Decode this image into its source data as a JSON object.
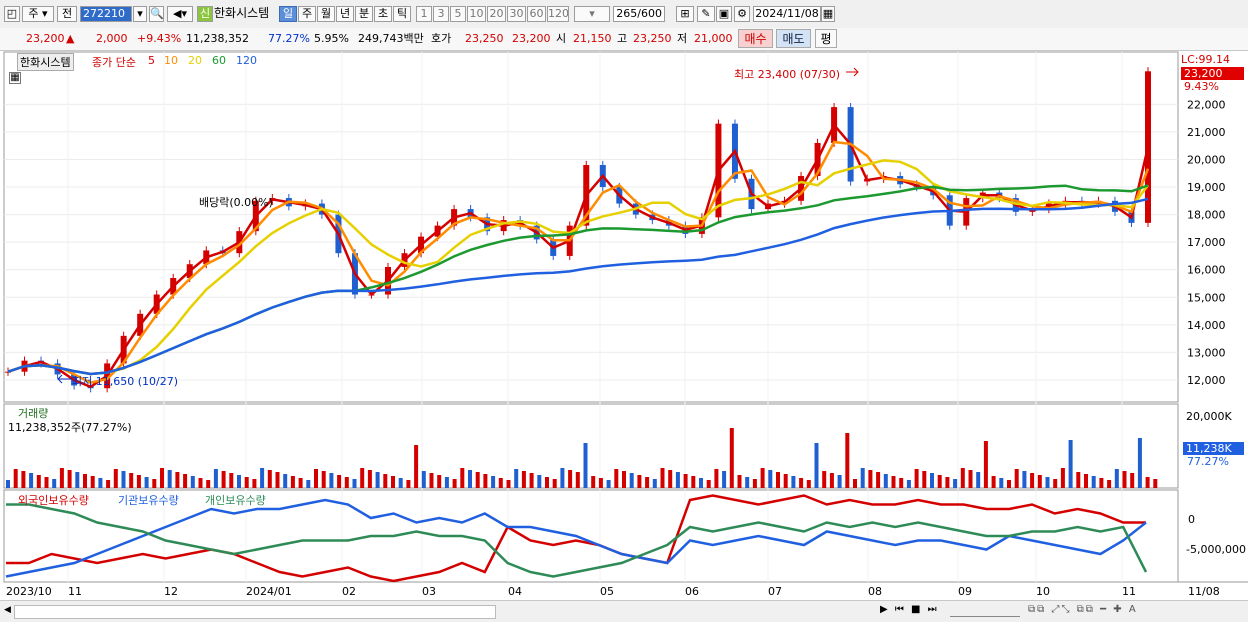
{
  "toolbar": {
    "market_label": "주",
    "prev_label": "전",
    "stock_code": "272210",
    "stock_name": "한화시스템",
    "new_label": "신",
    "period_buttons": [
      "일",
      "주",
      "월",
      "년",
      "분",
      "초",
      "틱"
    ],
    "active_period": "일",
    "interval_buttons": [
      "1",
      "3",
      "5",
      "10",
      "20",
      "30",
      "60",
      "120"
    ],
    "count_value": "265",
    "count_max": "/600",
    "date_value": "2024/11/08"
  },
  "quote": {
    "price": "23,200",
    "arrow": "▲",
    "change": "2,000",
    "change_rate": "+9.43%",
    "volume": "11,238,352",
    "vol_ratio": "77.27%",
    "turnover": "5.95%",
    "amount": "249,743백만",
    "hoga_label": "호가",
    "ask": "23,250",
    "bid": "23,200",
    "open_label": "시",
    "open": "21,150",
    "high_label": "고",
    "high": "23,250",
    "low_label": "저",
    "low": "21,000",
    "buy_label": "매수",
    "sell_label": "매도",
    "eval_label": "평"
  },
  "price_panel": {
    "name_tag": "한화시스템",
    "legend_prefix": "종가 단순",
    "ma_periods": [
      "5",
      "10",
      "20",
      "60",
      "120"
    ],
    "ma_colors": [
      "#d40000",
      "#ff8c00",
      "#e6d000",
      "#1c9a30",
      "#2060e0"
    ],
    "lc_label": "LC:99.14",
    "last_price_box": "23,200",
    "last_rate": "9.43%",
    "annot_high": "최고 23,400 (07/30)",
    "annot_low": "최저 11,650 (10/27)",
    "annot_div": "배당락(0.00%)"
  },
  "volume_panel": {
    "title": "거래량",
    "subtitle": "11,238,352주(77.27%)",
    "last_box": "11,238K",
    "last_rate": "77.27%",
    "tick_top": "20,000K"
  },
  "holding_panel": {
    "legend": [
      "외국인보유수량",
      "기관보유수량",
      "개인보유수량"
    ],
    "colors": [
      "#d40000",
      "#2060e0",
      "#2e8b57"
    ],
    "ticks": [
      "0",
      "-5,000,000"
    ]
  },
  "x_axis": {
    "labels": [
      "2023/10",
      "11",
      "12",
      "2024/01",
      "02",
      "03",
      "04",
      "05",
      "06",
      "07",
      "08",
      "09",
      "10",
      "11"
    ],
    "right_label": "11/08"
  },
  "chart_data": {
    "type": "line",
    "title": "",
    "y_ticks": [
      12000,
      13000,
      14000,
      15000,
      16000,
      17000,
      18000,
      19000,
      20000,
      21000,
      22000
    ],
    "y_tick_labels": [
      "12,000",
      "13,000",
      "14,000",
      "15,000",
      "16,000",
      "17,000",
      "18,000",
      "19,000",
      "20,000",
      "21,000",
      "22,000"
    ],
    "ylim": [
      11200,
      23900
    ],
    "series": [
      {
        "name": "종가",
        "values": [
          12300,
          12700,
          12600,
          12200,
          11800,
          11700,
          12600,
          13600,
          14400,
          15100,
          15700,
          16200,
          16700,
          16600,
          17400,
          18500,
          18600,
          18300,
          18400,
          18000,
          16600,
          15100,
          15100,
          16100,
          16600,
          17200,
          17600,
          18200,
          17900,
          17400,
          17800,
          17600,
          17100,
          16500,
          17600,
          19800,
          19000,
          18400,
          18000,
          17800,
          17600,
          17300,
          17900,
          21300,
          19300,
          18200,
          18400,
          18500,
          19400,
          20600,
          21900,
          19200,
          19300,
          19400,
          19100,
          19000,
          18700,
          17600,
          18600,
          18800,
          18600,
          18100,
          18200,
          18400,
          18500,
          18400,
          18500,
          18100,
          17700,
          23200
        ]
      }
    ],
    "ma_last_values": {
      "5": 18500,
      "10": 18600,
      "20": 18700,
      "60": 18700,
      "120": 18600
    }
  }
}
